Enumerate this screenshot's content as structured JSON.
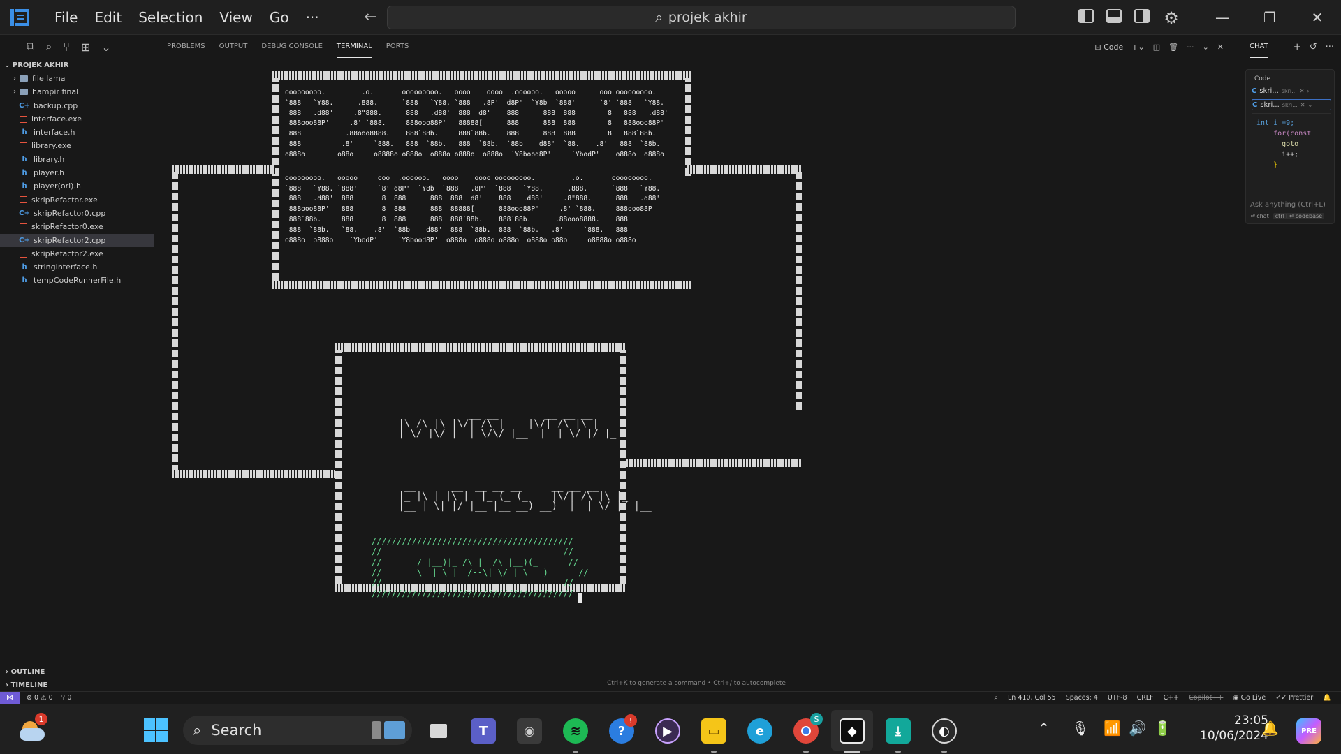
{
  "titlebar": {
    "menus": [
      "File",
      "Edit",
      "Selection",
      "View",
      "Go",
      "···"
    ],
    "search_text": "projek akhir"
  },
  "explorer": {
    "title": "PROJEK AKHIR",
    "items": [
      {
        "label": "file lama",
        "type": "folder"
      },
      {
        "label": "hampir final",
        "type": "folder"
      },
      {
        "label": "backup.cpp",
        "type": "cpp"
      },
      {
        "label": "interface.exe",
        "type": "exe"
      },
      {
        "label": "interface.h",
        "type": "h"
      },
      {
        "label": "library.exe",
        "type": "exe"
      },
      {
        "label": "library.h",
        "type": "h"
      },
      {
        "label": "player.h",
        "type": "h"
      },
      {
        "label": "player(ori).h",
        "type": "h"
      },
      {
        "label": "skripRefactor.exe",
        "type": "exe"
      },
      {
        "label": "skripRefactor0.cpp",
        "type": "cpp"
      },
      {
        "label": "skripRefactor0.exe",
        "type": "exe"
      },
      {
        "label": "skripRefactor2.cpp",
        "type": "cpp",
        "active": true
      },
      {
        "label": "skripRefactor2.exe",
        "type": "exe"
      },
      {
        "label": "stringInterface.h",
        "type": "h"
      },
      {
        "label": "tempCodeRunnerFile.h",
        "type": "h"
      }
    ],
    "outline": "OUTLINE",
    "timeline": "TIMELINE"
  },
  "panel": {
    "tabs": [
      "PROBLEMS",
      "OUTPUT",
      "DEBUG CONSOLE",
      "TERMINAL",
      "PORTS"
    ],
    "active_tab": "TERMINAL",
    "terminal_name": "Code",
    "hint": "Ctrl+K to generate a command • Ctrl+/ to autocomplete"
  },
  "terminal_art": {
    "title_lines": [
      "ooooooooo.         .o.       ooooooooo.   oooo    oooo  .oooooo.   ooooo      ooo ooooooooo.",
      "`888   `Y88.      .888.      `888   `Y88. `888   .8P'  d8P'  `Y8b  `888'      `8' `888   `Y88.",
      " 888   .d88'     .8\"888.      888   .d88'  888  d8'    888      888  888        8   888   .d88'",
      " 888ooo88P'     .8' `888.     888ooo88P'   88888[      888      888  888        8   888ooo88P'",
      " 888           .88ooo8888.    888`88b.     888`88b.    888      888  888        8   888`88b.",
      " 888          .8'     `888.   888  `88b.   888  `88b.  `88b    d88'  `88.    .8'   888  `88b.",
      "o888o        o88o     o8888o o888o  o888o o888o  o888o  `Y8bood8P'     `YbodP'    o888o  o888o",
      "",
      "",
      "ooooooooo.   ooooo     ooo  .oooooo.   oooo    oooo ooooooooo.         .o.       ooooooooo.",
      "`888   `Y88. `888'     `8' d8P'  `Y8b  `888   .8P'  `888   `Y88.      .888.      `888   `Y88.",
      " 888   .d88'  888       8  888      888  888  d8'    888   .d88'     .8\"888.      888   .d88'",
      " 888ooo88P'   888       8  888      888  88888[      888ooo88P'     .8' `888.     888ooo88P'",
      " 888`88b.     888       8  888      888  888`88b.    888`88b.      .88ooo8888.    888",
      " 888  `88b.   `88.    .8'  `88b    d88'  888  `88b.  888  `88b.   .8'     `888.   888",
      "o888o  o888o    `YbodP'     `Y8bood8P'  o888o  o888o o888o  o888o o88o     o8888o o888o"
    ],
    "menu_normal": [
      "             __ __        __ __ __",
      " |\\ /\\ |\\ |\\/| /\\ |    |\\/| /\\ |\\ |_",
      " | \\/ |\\/ |  | \\/\\/ |__  |  | \\/ |/ |_"
    ],
    "menu_endless": [
      "  __      __  __ __ __     __ __ __",
      " |_ |\\ | |\\ |  |_ (_ (_    |\\/| /\\ |\\ |_",
      " |__ | \\| |/ |__ |__ __) __)  |  | \\/ |/ |__"
    ],
    "creators": [
      "////////////////////////////////////////",
      "//        __ __  __ __ __ __ __       //",
      "//       / |__)|_ /\\ |  /\\ |__)(_      //",
      "//       \\__| \\ |__/--\\| \\/ | \\ __)      //",
      "//                                    //",
      "////////////////////////////////////////"
    ]
  },
  "chat": {
    "title": "CHAT",
    "code_label": "Code",
    "refs": [
      "skri...",
      "skri..."
    ],
    "ref_sub": "skri...",
    "code_lines": [
      "int i =9;",
      "    for(const",
      "      goto",
      "      i++;",
      "    }"
    ],
    "ask_placeholder": "Ask anything (Ctrl+L)",
    "foot_chat": "⏎ chat",
    "foot_codebase": "ctrl+⏎ codebase"
  },
  "statusbar": {
    "errors": "⊗ 0 ⚠ 0",
    "ports": "⑂ 0",
    "position": "Ln 410, Col 55",
    "spaces": "Spaces: 4",
    "encoding": "UTF-8",
    "eol": "CRLF",
    "language": "C++",
    "copilot": "Copilot++",
    "golive": "Go Live",
    "prettier": "Prettier"
  },
  "taskbar": {
    "search_label": "Search",
    "weather_badge": "1",
    "help_badge": "!",
    "chrome_badge": "S",
    "time": "23:05",
    "date": "10/06/2024"
  }
}
